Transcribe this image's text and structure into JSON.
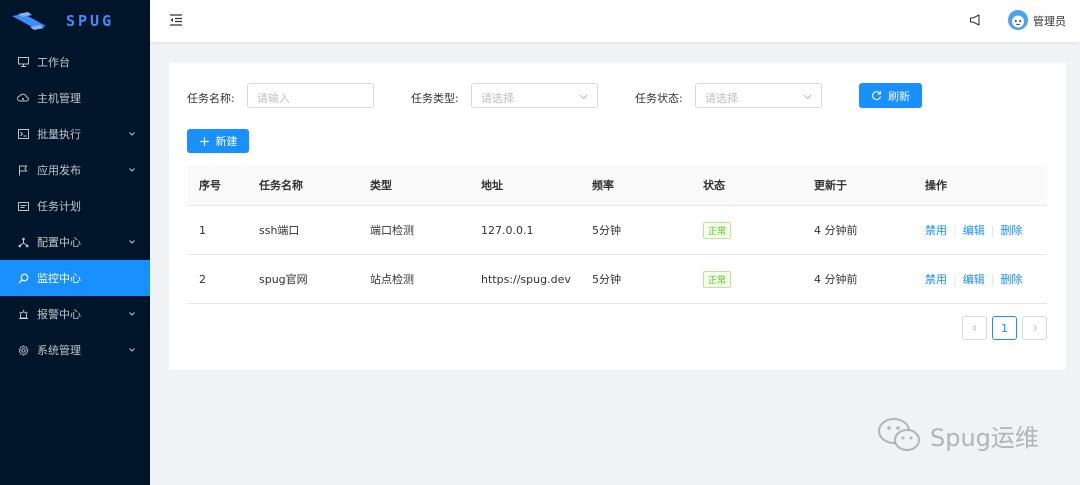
{
  "app": {
    "logo_text": "SPUG"
  },
  "sidebar": {
    "items": [
      {
        "label": "工作台",
        "icon": "monitor-icon",
        "has_submenu": false
      },
      {
        "label": "主机管理",
        "icon": "cloud-server-icon",
        "has_submenu": false
      },
      {
        "label": "批量执行",
        "icon": "terminal-icon",
        "has_submenu": true
      },
      {
        "label": "应用发布",
        "icon": "flag-icon",
        "has_submenu": true
      },
      {
        "label": "任务计划",
        "icon": "schedule-icon",
        "has_submenu": false
      },
      {
        "label": "配置中心",
        "icon": "deployment-icon",
        "has_submenu": true
      },
      {
        "label": "监控中心",
        "icon": "monitor-search-icon",
        "has_submenu": false,
        "active": true
      },
      {
        "label": "报警中心",
        "icon": "alarm-icon",
        "has_submenu": true
      },
      {
        "label": "系统管理",
        "icon": "setting-icon",
        "has_submenu": true
      }
    ]
  },
  "header": {
    "username": "管理员"
  },
  "filters": {
    "name_label": "任务名称:",
    "name_placeholder": "请输入",
    "type_label": "任务类型:",
    "type_placeholder": "请选择",
    "status_label": "任务状态:",
    "status_placeholder": "请选择",
    "refresh_label": "刷新"
  },
  "toolbar": {
    "new_label": "新建"
  },
  "table": {
    "columns": [
      "序号",
      "任务名称",
      "类型",
      "地址",
      "频率",
      "状态",
      "更新于",
      "操作"
    ],
    "rows": [
      {
        "index": "1",
        "name": "ssh端口",
        "type": "端口检测",
        "address": "127.0.0.1",
        "frequency": "5分钟",
        "status": "正常",
        "updated": "4 分钟前"
      },
      {
        "index": "2",
        "name": "spug官网",
        "type": "站点检测",
        "address": "https://spug.dev",
        "frequency": "5分钟",
        "status": "正常",
        "updated": "4 分钟前"
      }
    ],
    "actions": {
      "disable": "禁用",
      "edit": "编辑",
      "delete": "删除"
    }
  },
  "pagination": {
    "current_page": "1"
  },
  "watermark": {
    "text": "Spug运维"
  },
  "colors": {
    "sidebar_bg": "#001529",
    "accent": "#1890ff",
    "status_ok": "#52c41a"
  }
}
